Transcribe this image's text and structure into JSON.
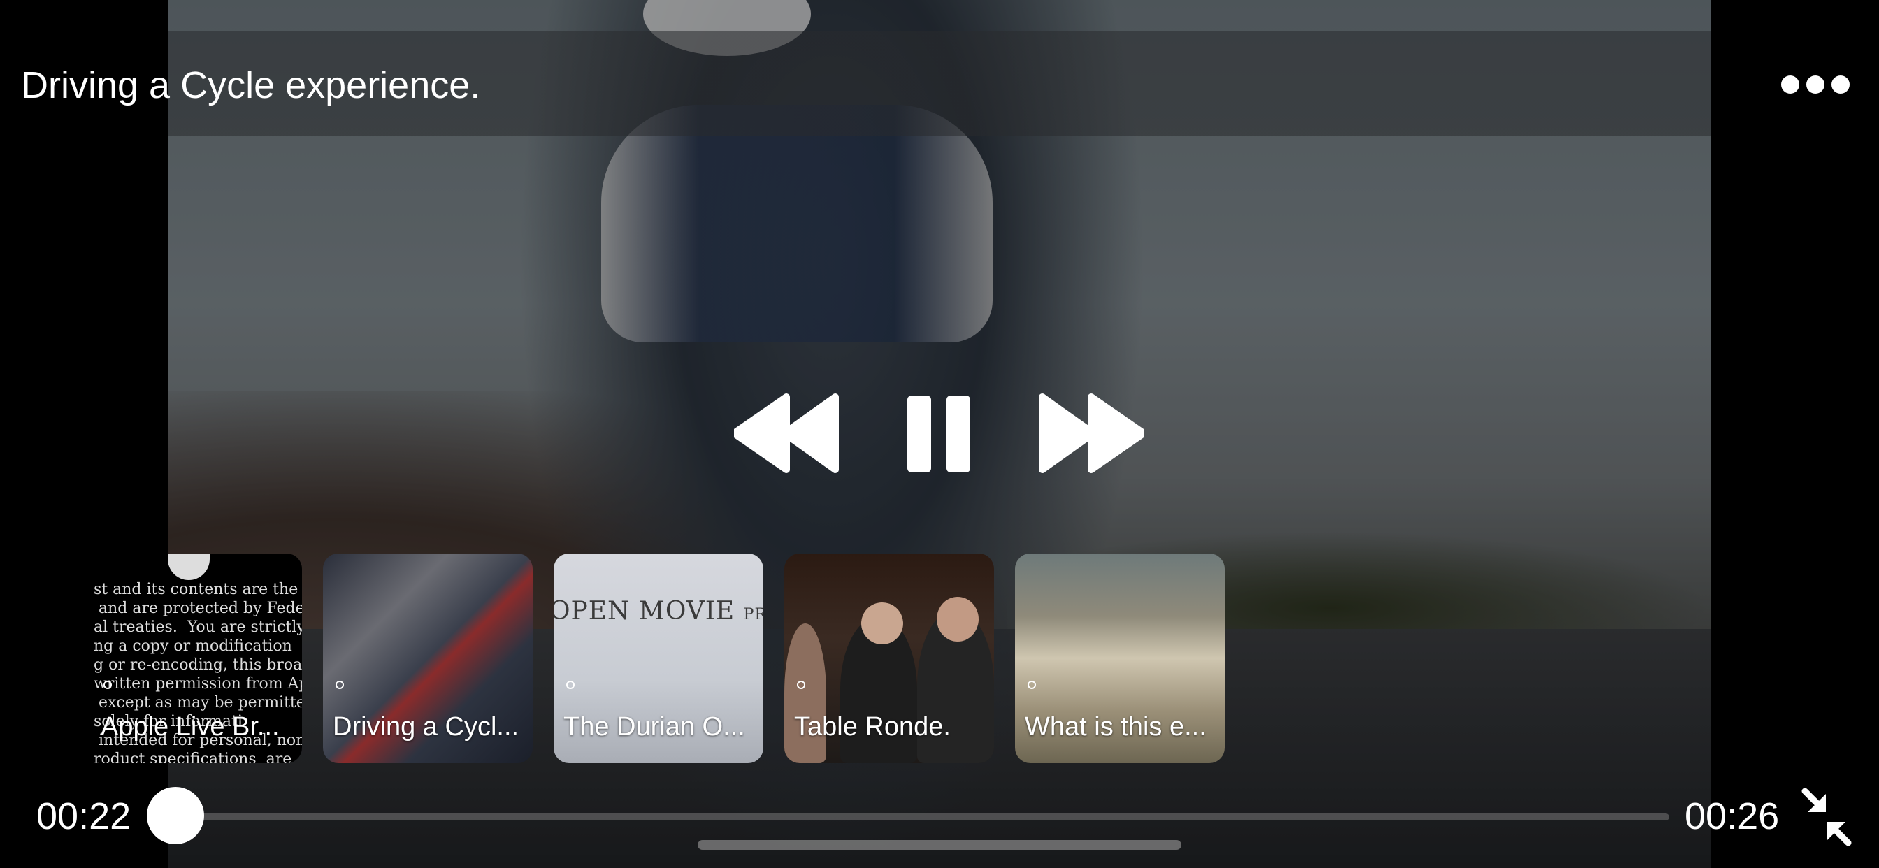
{
  "player": {
    "title": "Driving a Cycle experience.",
    "more_icon": "ellipsis-icon",
    "controls": {
      "rewind_icon": "rewind-icon",
      "pause_icon": "pause-icon",
      "forward_icon": "fast-forward-icon"
    },
    "elapsed": "00:22",
    "duration": "00:26",
    "progress": 0.0,
    "collapse_icon": "collapse-arrows-icon"
  },
  "playlist": [
    {
      "label": "Apple Live Br..."
    },
    {
      "label": "Driving a Cycl..."
    },
    {
      "label": "The Durian O..."
    },
    {
      "label": "Table Ronde."
    },
    {
      "label": "What is this e..."
    }
  ],
  "thumb_texts": {
    "legal": "st and its contents are the \n and are protected by Feder\nal treaties.  You are strictly\nng a copy or modification \ng or re-encoding, this broa\nwritten permission from Ap\n except as may be permitte\nsolely for informati\n intended for personal, non\nroduct specifications  are",
    "brand_main": "OPEN MOVIE",
    "brand_small": "PROJECT"
  },
  "colors": {
    "accent": "#ffffff",
    "background": "#000000"
  }
}
